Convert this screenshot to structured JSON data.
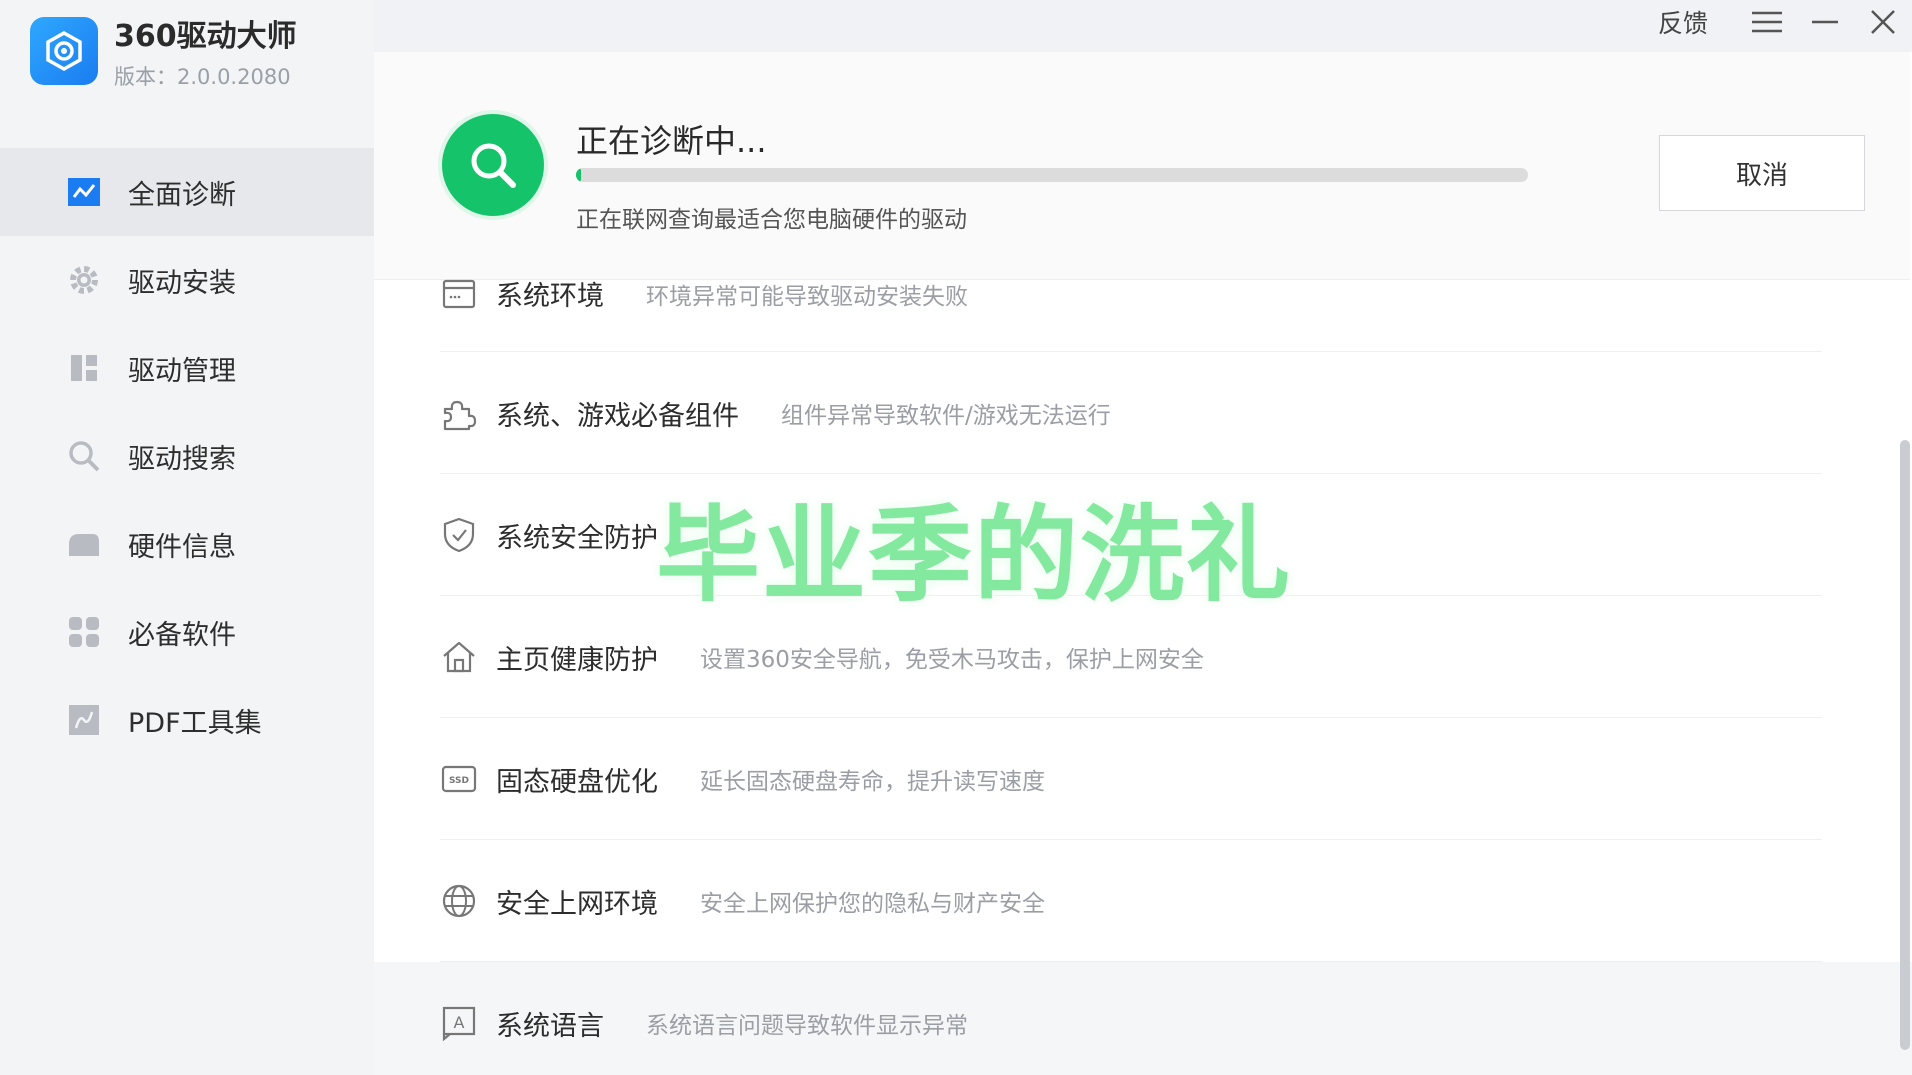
{
  "app": {
    "name": "360驱动大师",
    "version": "版本：2.0.0.2080"
  },
  "titlebar": {
    "feedback": "反馈",
    "menu_icon": "hamburger-menu-icon",
    "minimize_icon": "minimize-icon",
    "close_icon": "close-icon"
  },
  "sidebar": {
    "items": [
      {
        "label": "全面诊断",
        "icon": "diagnosis-chart-icon",
        "active": true
      },
      {
        "label": "驱动安装",
        "icon": "gear-icon"
      },
      {
        "label": "驱动管理",
        "icon": "grid-manage-icon"
      },
      {
        "label": "驱动搜索",
        "icon": "search-icon"
      },
      {
        "label": "硬件信息",
        "icon": "hardware-icon"
      },
      {
        "label": "必备软件",
        "icon": "apps-grid-icon"
      },
      {
        "label": "PDF工具集",
        "icon": "pdf-icon"
      }
    ]
  },
  "scan": {
    "title": "正在诊断中...",
    "subtitle": "正在联网查询最适合您电脑硬件的驱动",
    "progress": 0.005,
    "cancel": "取消"
  },
  "list": [
    {
      "title": "系统环境",
      "desc": "环境异常可能导致驱动安装失败",
      "icon": "window-icon"
    },
    {
      "title": "系统、游戏必备组件",
      "desc": "组件异常导致软件/游戏无法运行",
      "icon": "puzzle-icon"
    },
    {
      "title": "系统安全防护",
      "desc": "",
      "icon": "shield-icon"
    },
    {
      "title": "主页健康防护",
      "desc": "设置360安全导航，免受木马攻击，保护上网安全",
      "icon": "home-icon"
    },
    {
      "title": "固态硬盘优化",
      "desc": "延长固态硬盘寿命，提升读写速度",
      "icon": "ssd-icon"
    },
    {
      "title": "安全上网环境",
      "desc": "安全上网保护您的隐私与财产安全",
      "icon": "globe-icon"
    },
    {
      "title": "系统语言",
      "desc": "系统语言问题导致软件显示异常",
      "icon": "language-icon"
    }
  ],
  "overlay_caption": "毕业季的洗礼",
  "colors": {
    "accent_green": "#15c36a",
    "brand_blue": "#1a7cf0",
    "active_nav_bg": "#e6e8ec"
  }
}
